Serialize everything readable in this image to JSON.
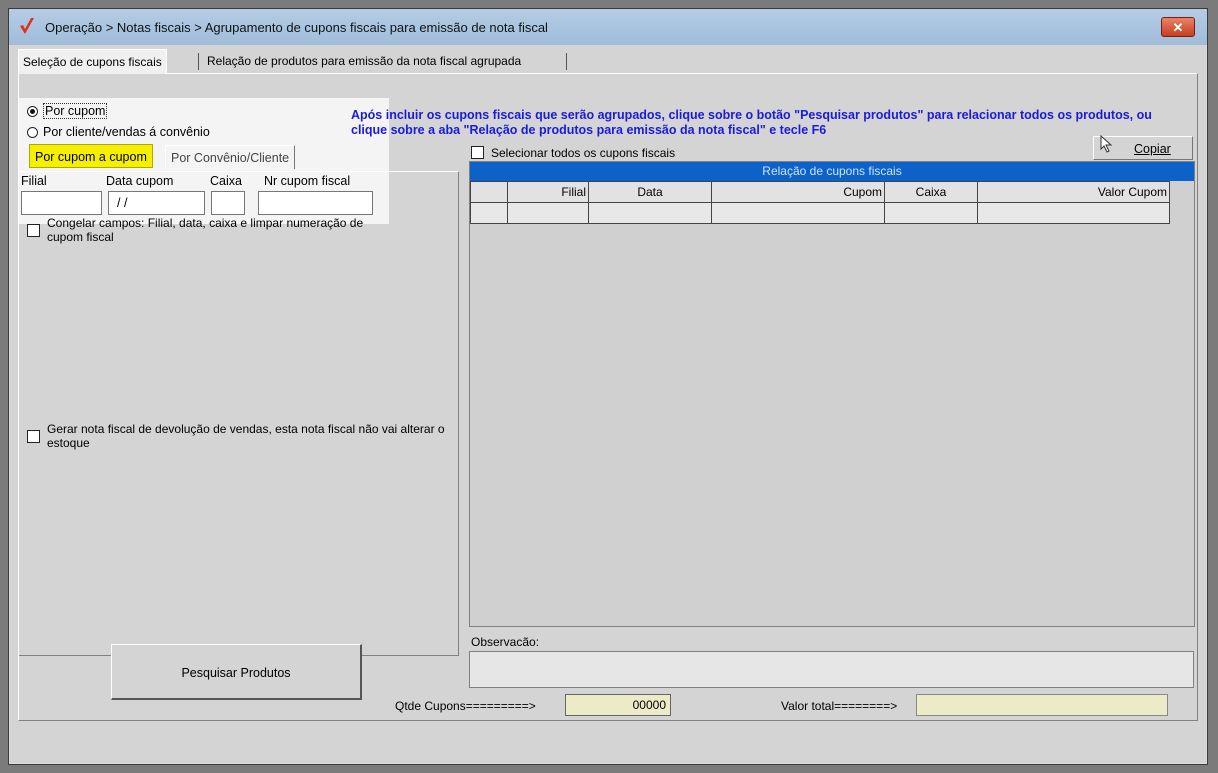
{
  "window": {
    "title": "Operação > Notas fiscais > Agrupamento de cupons fiscais para emissão de nota fiscal",
    "close_glyph": "✕"
  },
  "tabs": [
    {
      "label": "Seleção de cupons fiscais",
      "active": true
    },
    {
      "label": "Relação de produtos para emissão da nota fiscal agrupada",
      "active": false
    }
  ],
  "selection_mode": {
    "options": [
      "Por cupom",
      "Por cliente/vendas á convênio"
    ],
    "selected": "Por cupom"
  },
  "subtabs": [
    {
      "label": "Por cupom a cupom",
      "active": true
    },
    {
      "label": "Por Convênio/Cliente",
      "active": false
    }
  ],
  "filters": {
    "filial_label": "Filial",
    "filial_value": "",
    "data_label": "Data cupom",
    "data_value": " /  /",
    "caixa_label": "Caixa",
    "caixa_value": "",
    "nr_label": "Nr cupom fiscal",
    "nr_value": ""
  },
  "options": {
    "freeze_label": "Congelar campos: Filial, data, caixa e limpar numeração de cupom fiscal",
    "freeze_checked": false,
    "return_label": "Gerar nota fiscal de devolução de vendas, esta nota fiscal não vai alterar o estoque",
    "return_checked": false
  },
  "info_message": "Após incluir os cupons fiscais que serão agrupados, clique sobre o botão \"Pesquisar produtos\" para relacionar todos os produtos, ou clique sobre a aba \"Relação de produtos para emissão da nota fiscal\" e tecle F6",
  "copy_button": "Copiar",
  "select_all_label": "Selecionar todos os cupons fiscais",
  "grid": {
    "caption": "Relação de cupons fiscais",
    "columns": [
      "",
      "Filial",
      "Data",
      "Cupom",
      "Caixa",
      "Valor Cupom"
    ]
  },
  "observacao_label": "Observacão:",
  "search_button": "Pesquisar Produtos",
  "totals": {
    "qtd_label": "Qtde Cupons=========>",
    "qtd_value": "00000",
    "valor_label": "Valor total========>",
    "valor_value": ""
  },
  "colors": {
    "accent_blue": "#0c62c8",
    "info_text": "#1a1ae0",
    "highlight_yellow": "#f6f000",
    "total_field": "#ecebc8"
  }
}
